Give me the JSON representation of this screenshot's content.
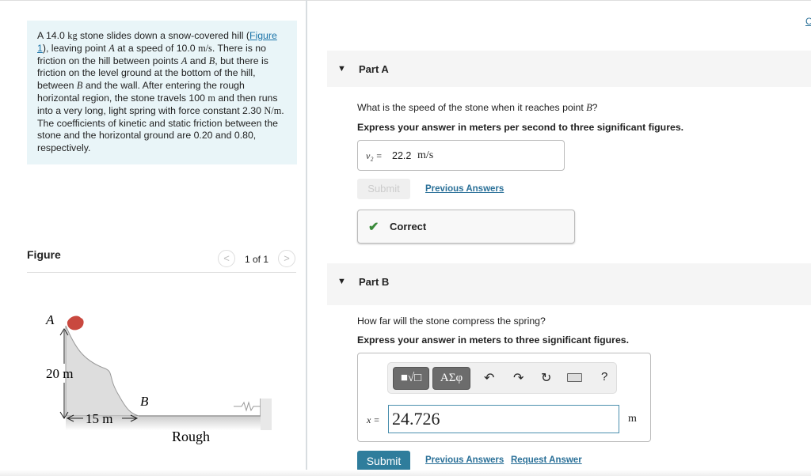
{
  "problem": {
    "p1": "A 14.0 ",
    "kg": "kg",
    "p2": " stone slides down a snow-covered hill (",
    "figlink": "Figure 1",
    "p3": "), leaving point ",
    "A": "A",
    "p4": " at a speed of 10.0 ",
    "ms": "m/s",
    "p5": ". There is no friction on the hill between points ",
    "A2": "A",
    "p6": " and ",
    "B": "B",
    "p7": ", but there is friction on the level ground at the bottom of the hill, between ",
    "B2": "B",
    "p8": " and the wall. After entering the rough horizontal region, the stone travels 100 ",
    "m": "m",
    "p9": " and then runs into a very long, light spring with force constant 2.30 ",
    "Nm": "N/m",
    "p10": ". The coefficients of kinetic and static friction between the stone and the horizontal ground are 0.20 and 0.80, respectively."
  },
  "figure": {
    "title": "Figure",
    "pager": "1 of 1",
    "prev": "<",
    "next": ">",
    "labels": {
      "A": "A",
      "height": "20 m",
      "B": "B",
      "width": "15 m",
      "rough": "Rough"
    }
  },
  "partA": {
    "header": "Part A",
    "question_pre": "What is the speed of the stone when it reaches point ",
    "question_var": "B",
    "question_post": "?",
    "instruction": "Express your answer in meters per second to three significant figures.",
    "answer_label": "v₂ =",
    "answer_value": "22.2",
    "answer_unit": "m/s",
    "submit": "Submit",
    "previous": "Previous Answers",
    "feedback": "Correct"
  },
  "partB": {
    "header": "Part B",
    "question": "How far will the stone compress the spring?",
    "instruction": "Express your answer in meters to three significant figures.",
    "toolbar": {
      "templates": "■√□",
      "symbols": "ΑΣφ",
      "help": "?"
    },
    "answer_label": "x =",
    "answer_value": "24.726",
    "answer_unit": "m",
    "submit": "Submit",
    "previous": "Previous Answers",
    "request": "Request Answer"
  },
  "corner_link": "C",
  "colors": {
    "accent": "#2f7d9c",
    "correct": "#3a8a3a",
    "panel": "#e9f5f8"
  }
}
